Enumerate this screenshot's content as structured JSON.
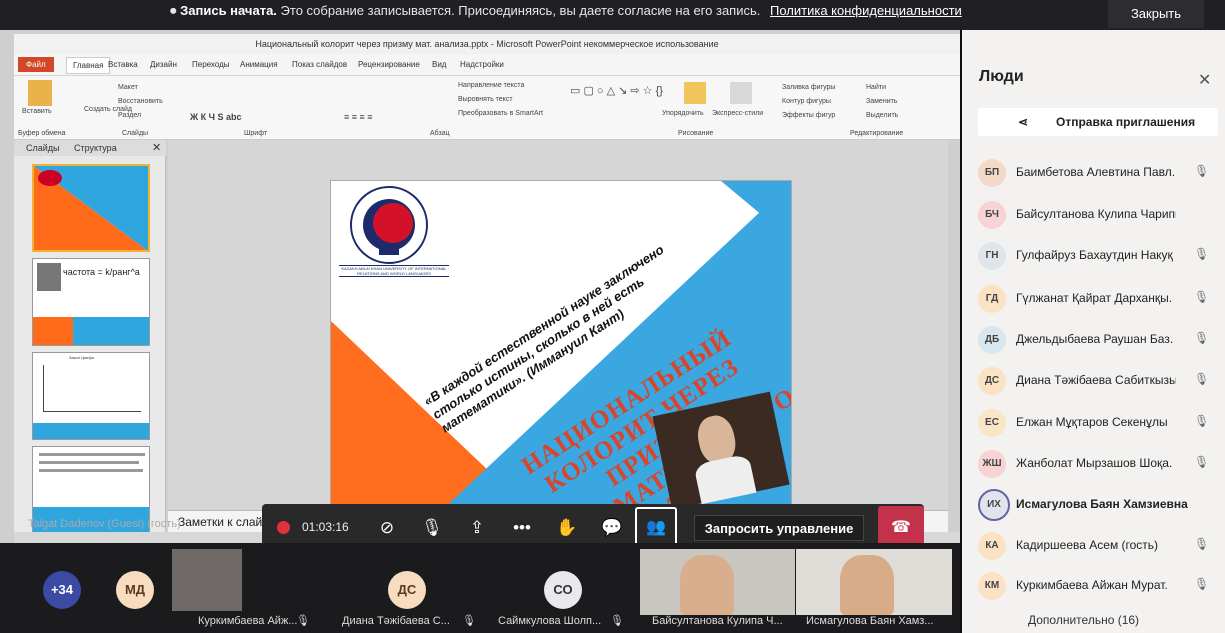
{
  "banner": {
    "bold": "Запись начата.",
    "text": "Это собрание записывается. Присоединяясь, вы даете согласие на его запись.",
    "link": "Политика конфиденциальности",
    "close_label": "Закрыть"
  },
  "ppt": {
    "title": "Национальный колорит через призму мат. анализа.pptx - Microsoft PowerPoint некоммерческое использование",
    "tabs": [
      "Файл",
      "Главная",
      "Вставка",
      "Дизайн",
      "Переходы",
      "Анимация",
      "Показ слайдов",
      "Рецензирование",
      "Вид",
      "Надстройки"
    ],
    "ribbon": {
      "paste": "Вставить",
      "create_slide": "Создать слайд",
      "layout": "Макет",
      "restore": "Восстановить",
      "section": "Раздел",
      "clipboard": "Буфер обмена",
      "slides": "Слайды",
      "font": "Шрифт",
      "paragraph": "Абзац",
      "text_direction": "Направление текста",
      "align_text": "Выровнять текст",
      "smartart": "Преобразовать в SmartArt",
      "arrange": "Упорядочить",
      "express_styles": "Экспресс-стили",
      "fill": "Заливка фигуры",
      "outline": "Контур фигуры",
      "effects": "Эффекты фигур",
      "drawing": "Рисование",
      "find": "Найти",
      "replace": "Заменить",
      "select": "Выделить",
      "editing": "Редактирование"
    },
    "pane_tabs": [
      "Слайды",
      "Структура"
    ],
    "thumb2_title": "частота = k/ранг^a",
    "thumb3_title": "Закон Ципфа",
    "notes": "Заметки к слайду",
    "presenter": "Talgat Dadenov (Guest) (гость)"
  },
  "slide": {
    "university": "KAZAKH ABLAI KHAN UNIVERSITY OF INTERNATIONAL RELATIONS AND WORLD LANGUAGES",
    "quote": "«В каждой естественной науке заключено столько истины, сколько в ней есть математики». (Иммануил Кант)",
    "title": "НАЦИОНАЛЬНЫЙ КОЛОРИТ ЧЕРЕЗ ПРИЗМУ МАТЕМАТИЧЕСКОГО АНАЛИЗА"
  },
  "controls": {
    "timer": "01:03:16",
    "request_control": "Запросить управление"
  },
  "bottom": {
    "more_count": "+34",
    "tiles": [
      {
        "initials": "МД",
        "name": ""
      },
      {
        "initials": "",
        "name": "Куркимбаева Айж..."
      },
      {
        "initials": "ДС",
        "name": "Диана Тәжібаева С..."
      },
      {
        "initials": "СО",
        "name": "Саймкулова Шолп..."
      },
      {
        "initials": "",
        "name": "Байсултанова Кулипа Ч..."
      },
      {
        "initials": "",
        "name": "Исмагулова Баян Хамз..."
      }
    ]
  },
  "panel": {
    "title": "Люди",
    "invite": "Отправка приглашения",
    "people": [
      {
        "initials": "БП",
        "name": "Баимбетова Алевтина Павл.",
        "color": "#f3d9c8"
      },
      {
        "initials": "БЧ",
        "name": "Байсултанова Кулипа Чарипкано",
        "color": "#f7d3d3"
      },
      {
        "initials": "ГН",
        "name": "Гулфайруз Бахаутдин Накуқ",
        "color": "#dfe5e8"
      },
      {
        "initials": "ГД",
        "name": "Гүлжанат Қайрат Дарханқы.",
        "color": "#fbe2c4"
      },
      {
        "initials": "ДБ",
        "name": "Джельдыбаева Раушан Баз.",
        "color": "#d8e6ef"
      },
      {
        "initials": "ДС",
        "name": "Диана Тәжібаева Сабиткызы",
        "color": "#fbe2c4"
      },
      {
        "initials": "ЕС",
        "name": "Елжан Мұқтаров Секенұлы",
        "color": "#f9e6c7"
      },
      {
        "initials": "ЖШ",
        "name": "Жанболат Мырзашов Шоқа.",
        "color": "#f7d3d3"
      },
      {
        "initials": "ИХ",
        "name": "Исмагулова Баян Хамзиевна",
        "color": "#e3e3ee"
      },
      {
        "initials": "КА",
        "name": "Кадиршеева Асем (гость)",
        "color": "#fbe2c4"
      },
      {
        "initials": "КМ",
        "name": "Куркимбаева Айжан Мурат.",
        "color": "#fbe2c4"
      }
    ],
    "more": "Дополнительно (16)"
  }
}
